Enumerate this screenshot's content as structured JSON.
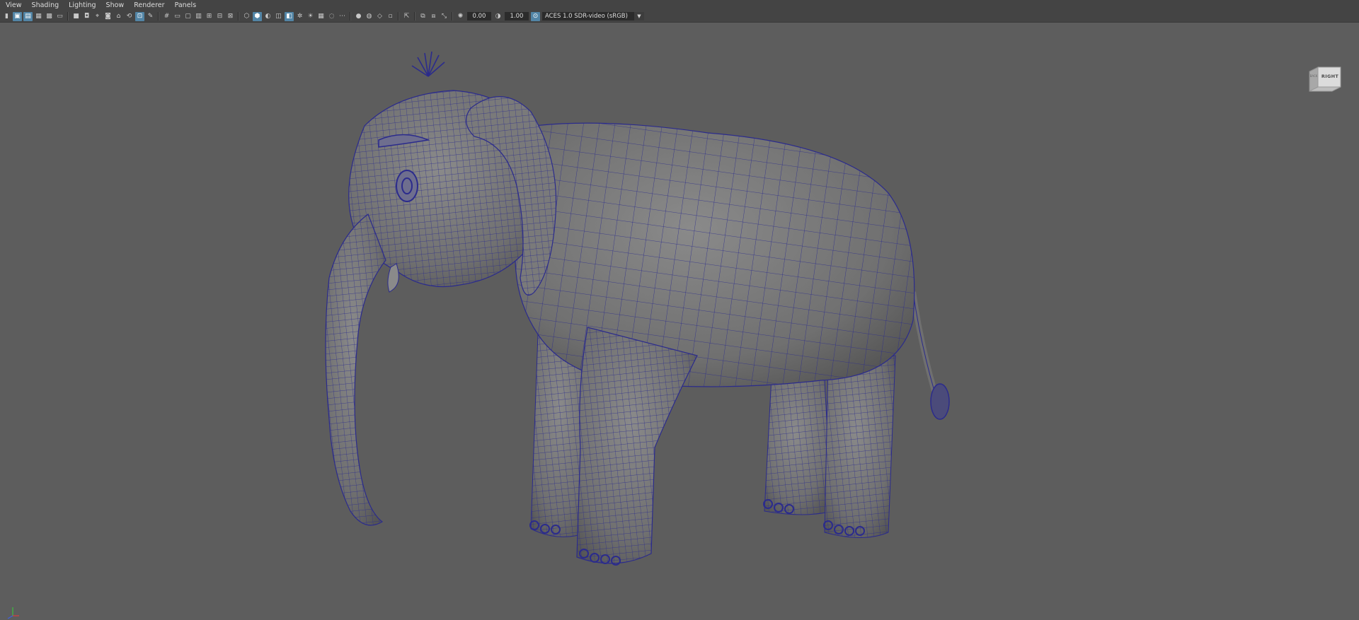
{
  "menu": [
    "View",
    "Shading",
    "Lighting",
    "Show",
    "Renderer",
    "Panels"
  ],
  "toolbar": {
    "exposure_value": "0.00",
    "gamma_value": "1.00",
    "color_space": "ACES 1.0 SDR-video (sRGB)"
  },
  "viewcube": {
    "face_label": "RIGHT",
    "side_label": "BACK"
  },
  "colors": {
    "viewport_bg": "#5d5d5d",
    "wireframe": "#2b2b8c",
    "toolbar_bg": "#444444",
    "active_highlight": "#5285a6"
  }
}
